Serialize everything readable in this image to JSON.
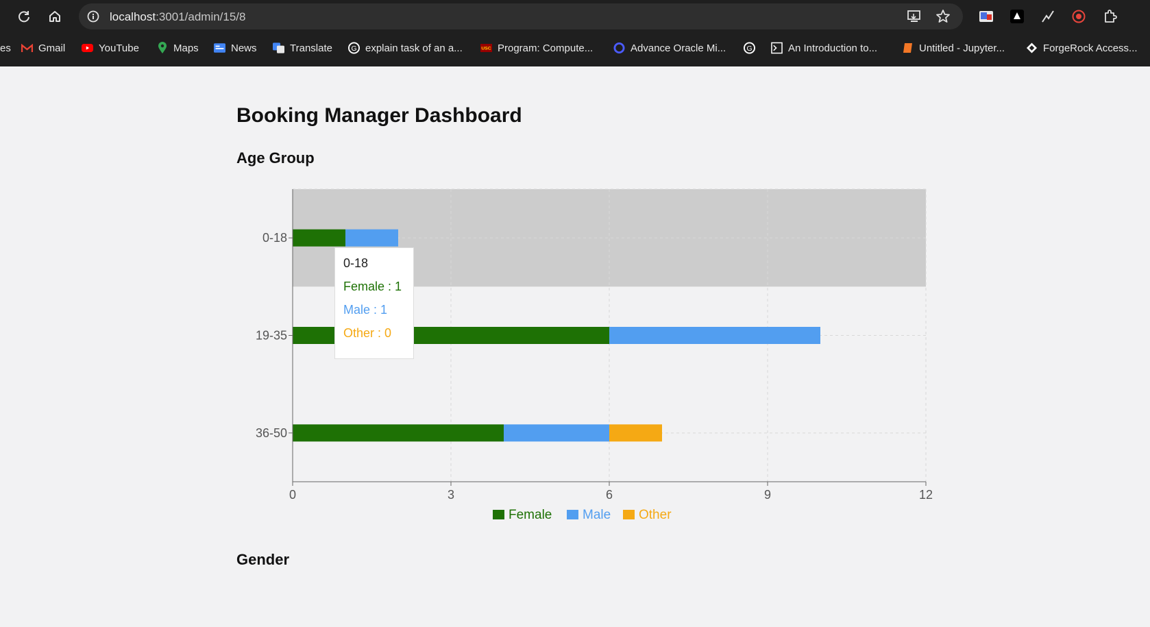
{
  "browser": {
    "url_host": "localhost",
    "url_path": ":3001/admin/15/8",
    "bookmarks": [
      {
        "label": "es",
        "icon": "bookmark-icon"
      },
      {
        "label": "Gmail",
        "icon": "gmail-icon",
        "color": "#ea4335"
      },
      {
        "label": "YouTube",
        "icon": "youtube-icon",
        "color": "#ff0000"
      },
      {
        "label": "Maps",
        "icon": "maps-icon",
        "color": "#34a853"
      },
      {
        "label": "News",
        "icon": "news-icon",
        "color": "#4285f4"
      },
      {
        "label": "Translate",
        "icon": "translate-icon",
        "color": "#4285f4"
      },
      {
        "label": "explain task of an a...",
        "icon": "google-icon",
        "color": "#ffffff"
      },
      {
        "label": "Program: Compute...",
        "icon": "usc-icon",
        "color": "#990000"
      },
      {
        "label": "Advance Oracle Mi...",
        "icon": "q-icon",
        "color": "#4b5bff"
      },
      {
        "label": "",
        "icon": "google-icon",
        "color": "#ffffff"
      },
      {
        "label": "An Introduction to...",
        "icon": "terminal-icon",
        "color": "#ffffff"
      },
      {
        "label": "Untitled - Jupyter...",
        "icon": "jupyter-icon",
        "color": "#f37726"
      },
      {
        "label": "ForgeRock Access...",
        "icon": "forgerock-icon",
        "color": "#ffffff"
      }
    ]
  },
  "page": {
    "title": "Booking Manager Dashboard",
    "section_age": "Age Group",
    "section_gender": "Gender"
  },
  "colors": {
    "female": "#1e7105",
    "male": "#529ef0",
    "other": "#f5a914"
  },
  "chart_data": {
    "type": "bar",
    "orientation": "horizontal",
    "stacked": true,
    "categories": [
      "0-18",
      "19-35",
      "36-50"
    ],
    "series": [
      {
        "name": "Female",
        "values": [
          1,
          6,
          4
        ],
        "color": "#1e7105"
      },
      {
        "name": "Male",
        "values": [
          1,
          4,
          2
        ],
        "color": "#529ef0"
      },
      {
        "name": "Other",
        "values": [
          0,
          0,
          1
        ],
        "color": "#f5a914"
      }
    ],
    "xlim": [
      0,
      12
    ],
    "xticks": [
      0,
      3,
      6,
      9,
      12
    ],
    "grid": true,
    "legend_position": "bottom",
    "highlighted_category": "0-18"
  },
  "tooltip": {
    "title": "0-18",
    "lines": [
      "Female : 1",
      "Male : 1",
      "Other : 0"
    ]
  }
}
